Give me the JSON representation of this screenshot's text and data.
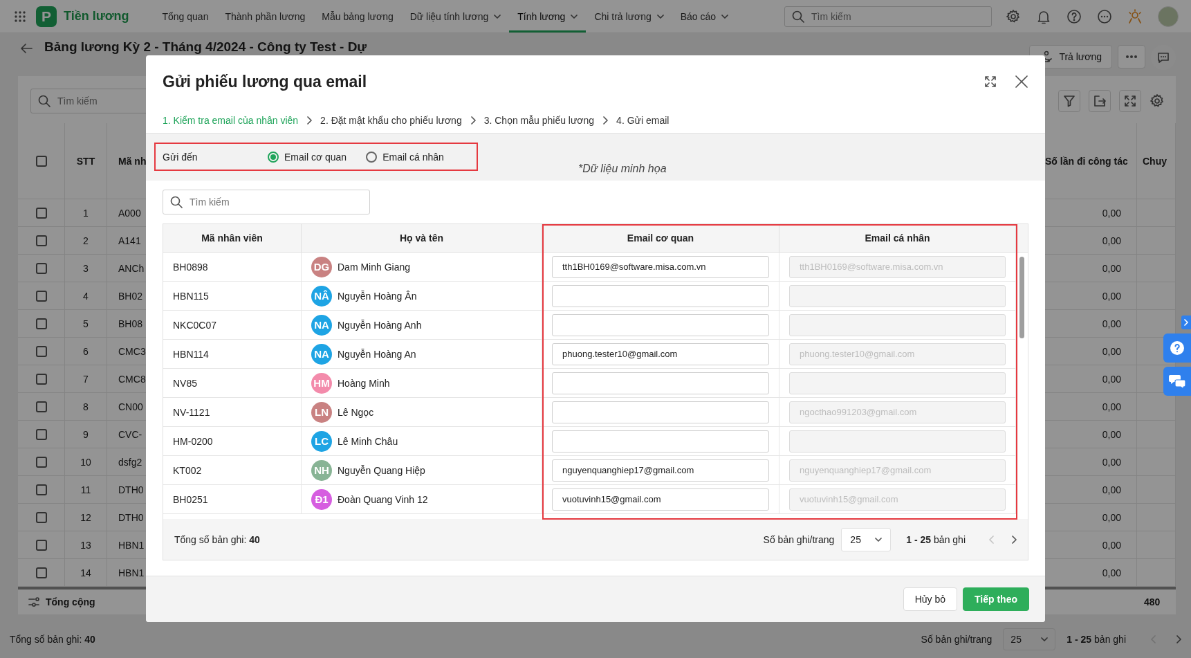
{
  "app": {
    "logo_letter": "P",
    "name": "Tiền lương"
  },
  "nav": [
    {
      "label": "Tổng quan",
      "selected": false,
      "dropdown": false
    },
    {
      "label": "Thành phần lương",
      "selected": false,
      "dropdown": false
    },
    {
      "label": "Mẫu bảng lương",
      "selected": false,
      "dropdown": false
    },
    {
      "label": "Dữ liệu tính lương",
      "selected": false,
      "dropdown": true
    },
    {
      "label": "Tính lương",
      "selected": true,
      "dropdown": true
    },
    {
      "label": "Chi trả lương",
      "selected": false,
      "dropdown": true
    },
    {
      "label": "Báo cáo",
      "selected": false,
      "dropdown": true
    }
  ],
  "search": {
    "placeholder": "Tìm kiếm"
  },
  "page": {
    "title": "Bảng lương Kỳ 2 - Tháng 4/2024 - Công ty Test - Dự",
    "pay_button": "Trả lương"
  },
  "sheet": {
    "search_placeholder": "Tìm kiếm",
    "header_checked": false,
    "columns": [
      "STT",
      "Mã nh",
      "Số lần đi công tác",
      "Chuy"
    ],
    "rows": [
      {
        "stt": "1",
        "code": "A000",
        "trips": "0,00",
        "checked": false
      },
      {
        "stt": "2",
        "code": "A141",
        "trips": "0,00",
        "checked": false
      },
      {
        "stt": "3",
        "code": "ANCh",
        "trips": "0,00",
        "checked": false
      },
      {
        "stt": "4",
        "code": "BH02",
        "trips": "0,00",
        "checked": false
      },
      {
        "stt": "5",
        "code": "BH08",
        "trips": "0,00",
        "checked": false
      },
      {
        "stt": "6",
        "code": "CMC3",
        "trips": "0,00",
        "checked": false
      },
      {
        "stt": "7",
        "code": "CMC8",
        "trips": "0,00",
        "checked": false
      },
      {
        "stt": "8",
        "code": "CN00",
        "trips": "0,00",
        "checked": false
      },
      {
        "stt": "9",
        "code": "CVC-",
        "trips": "0,00",
        "checked": false
      },
      {
        "stt": "10",
        "code": "dsfg2",
        "trips": "0,00",
        "checked": false
      },
      {
        "stt": "11",
        "code": "DTH0",
        "trips": "0,00",
        "checked": false
      },
      {
        "stt": "12",
        "code": "DTH0",
        "trips": "0,00",
        "checked": false
      },
      {
        "stt": "13",
        "code": "HBN1",
        "trips": "0,00",
        "checked": false
      },
      {
        "stt": "14",
        "code": "HBN1",
        "trips": "0,00",
        "checked": false
      }
    ],
    "total_label": "Tổng cộng",
    "total_value": "480",
    "footer": {
      "total": "Tổng số bản ghi: **40**",
      "page_size_label": "Số bản ghi/trang",
      "page_size": "25",
      "range": "**1 - 25** bản ghi",
      "prev_disabled": true,
      "next_disabled": false
    }
  },
  "dialog": {
    "title": "Gửi phiếu lương qua email",
    "steps": [
      {
        "label": "1. Kiểm tra email của nhân viên",
        "selected": true
      },
      {
        "label": "2. Đặt mật khẩu cho phiếu lương",
        "selected": false
      },
      {
        "label": "3. Chọn mẫu phiếu lương",
        "selected": false
      },
      {
        "label": "4. Gửi email",
        "selected": false
      }
    ],
    "send_to": {
      "label": "Gửi đến",
      "options": [
        {
          "label": "Email cơ quan",
          "selected": true
        },
        {
          "label": "Email cá nhân",
          "selected": false
        }
      ]
    },
    "note": "*Dữ liệu minh họa",
    "search_placeholder": "Tìm kiếm",
    "columns": [
      {
        "label": "Mã nhân viên"
      },
      {
        "label": "Họ và tên"
      },
      {
        "label": "Email cơ quan",
        "disabled": false
      },
      {
        "label": "Email cá nhân",
        "disabled": true
      }
    ],
    "rows": [
      {
        "code": "BH0898",
        "initials": "DG",
        "color": "#c98282",
        "name": "Dam Minh Giang",
        "work_email": "tth1BH0169@software.misa.com.vn",
        "personal_email": "tth1BH0169@software.misa.com.vn"
      },
      {
        "code": "HBN115",
        "initials": "NÂ",
        "color": "#1ea4e4",
        "name": "Nguyễn Hoàng Ân"
      },
      {
        "code": "NKC0C07",
        "initials": "NA",
        "color": "#1ea4e4",
        "name": "Nguyễn Hoàng Anh"
      },
      {
        "code": "HBN114",
        "initials": "NA",
        "color": "#1ea4e4",
        "name": "Nguyễn Hoàng An",
        "work_email": "phuong.tester10@gmail.com",
        "personal_email": "phuong.tester10@gmail.com"
      },
      {
        "code": "NV85",
        "initials": "HM",
        "color": "#f38bab",
        "name": "Hoàng Minh"
      },
      {
        "code": "NV-1121",
        "initials": "LN",
        "color": "#c98282",
        "name": "Lê Ngọc",
        "personal_email": "ngocthao991203@gmail.com"
      },
      {
        "code": "HM-0200",
        "initials": "LC",
        "color": "#1ea4e4",
        "name": "Lê Minh Châu"
      },
      {
        "code": "KT002",
        "initials": "NH",
        "color": "#88b495",
        "name": "Nguyễn Quang Hiệp",
        "work_email": "nguyenquanghiep17@gmail.com",
        "personal_email": "nguyenquanghiep17@gmail.com"
      },
      {
        "code": "BH0251",
        "initials": "Đ1",
        "color": "#d65ee0",
        "name": "Đoàn Quang Vinh 12",
        "work_email": "vuotuvinh15@gmail.com",
        "personal_email": "vuotuvinh15@gmail.com"
      }
    ],
    "footer": {
      "total": "Tổng số bản ghi: **40**",
      "page_size_label": "Số bản ghi/trang",
      "page_size": "25",
      "range": "**1 - 25** bản ghi",
      "prev_disabled": true,
      "next_disabled": false
    },
    "buttons": [
      {
        "label": "Hủy bỏ",
        "kind": "secondary"
      },
      {
        "label": "Tiếp theo",
        "kind": "primary"
      }
    ]
  }
}
